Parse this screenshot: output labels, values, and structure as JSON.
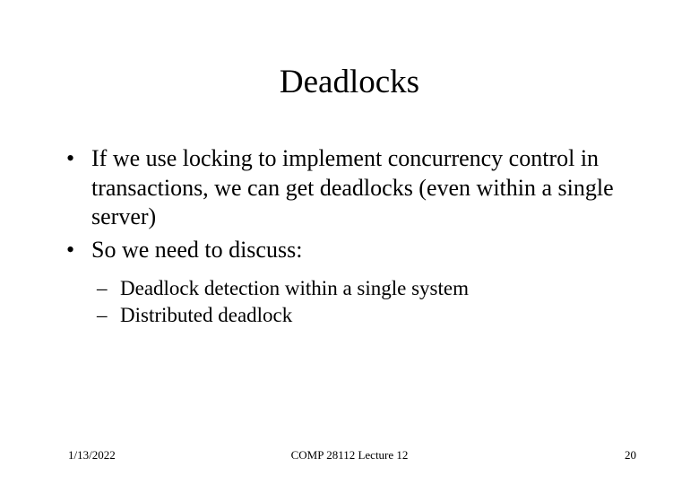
{
  "title": "Deadlocks",
  "bullets": [
    "If we use locking to implement concurrency control in transactions, we can get deadlocks (even within a single server)",
    "So we need to discuss:"
  ],
  "subbullets": [
    "Deadlock detection within a single system",
    "Distributed deadlock"
  ],
  "footer": {
    "date": "1/13/2022",
    "course": "COMP 28112 Lecture 12",
    "page": "20"
  }
}
